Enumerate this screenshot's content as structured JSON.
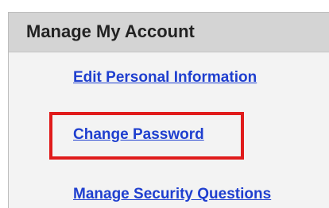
{
  "panel": {
    "title": "Manage My Account",
    "links": [
      {
        "label": "Edit Personal Information"
      },
      {
        "label": "Change Password"
      },
      {
        "label": "Manage Security Questions"
      }
    ]
  },
  "colors": {
    "link": "#1f3fcf",
    "header_bg": "#d4d4d4",
    "panel_bg": "#f3f3f3",
    "highlight": "#e01b1b"
  }
}
